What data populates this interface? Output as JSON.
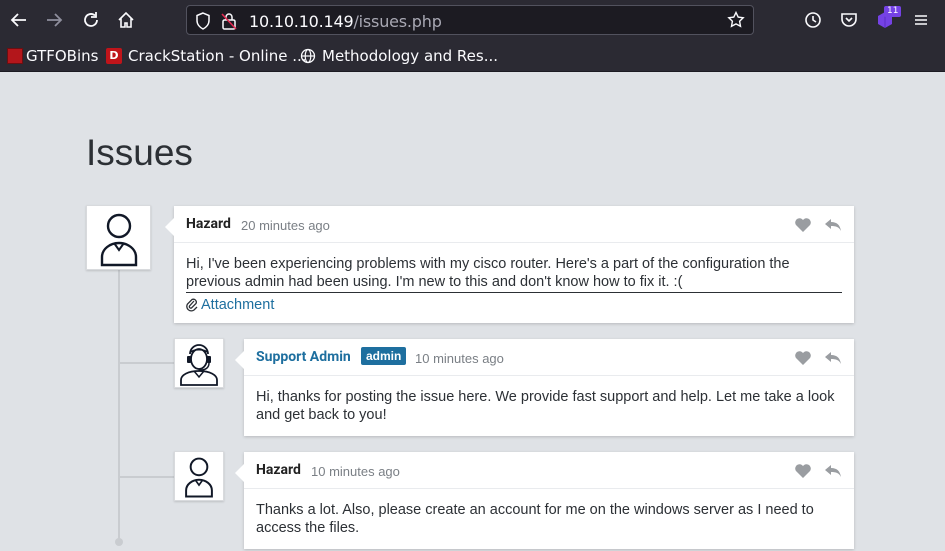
{
  "browser": {
    "url_host": "10.10.10.149",
    "url_path": "/issues.php",
    "extensions_badge": "11",
    "bookmarks": [
      {
        "label": "GTFOBins"
      },
      {
        "label": "CrackStation - Online ..."
      },
      {
        "label": "Methodology and Res..."
      }
    ]
  },
  "page": {
    "title": "Issues"
  },
  "comments": [
    {
      "author": "Hazard",
      "time": "20 minutes ago",
      "text": "Hi, I've been experiencing problems with my cisco router. Here's a part of the configuration the previous admin had been using. I'm new to this and don't know how to fix it. :(",
      "attachment": "Attachment"
    },
    {
      "author": "Support Admin",
      "role": "admin",
      "time": "10 minutes ago",
      "text": "Hi, thanks for posting the issue here. We provide fast support and help. Let me take a look and get back to you!"
    },
    {
      "author": "Hazard",
      "time": "10 minutes ago",
      "text": "Thanks a lot. Also, please create an account for me on the windows server as I need to access the files."
    }
  ],
  "colors": {
    "accent": "#1e6f9f",
    "page_bg": "#dfe2e6",
    "toolbar_bg": "#2b2a33"
  }
}
